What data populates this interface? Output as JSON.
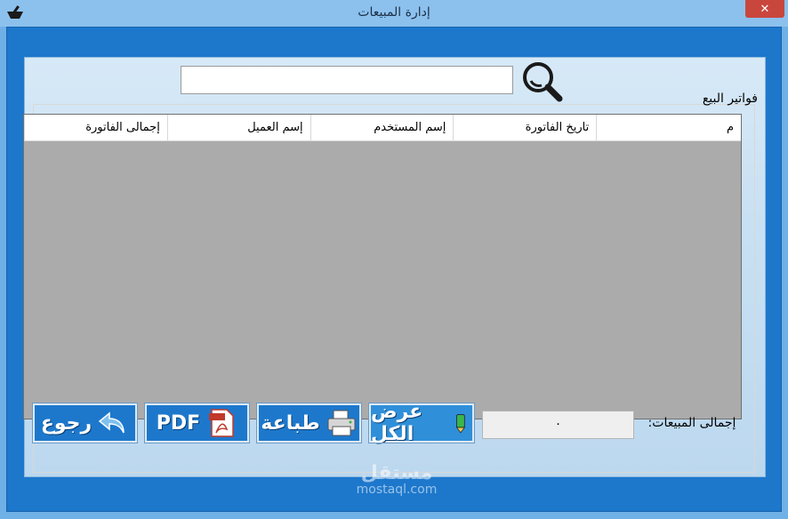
{
  "window": {
    "title": "إدارة المبيعات",
    "close_label": "✕"
  },
  "search": {
    "value": "",
    "placeholder": ""
  },
  "group": {
    "label": "فواتير البيع"
  },
  "table": {
    "columns": [
      "م",
      "تاريخ الفاتورة",
      "إسم المستخدم",
      "إسم العميل",
      "إجمالى الفاتورة"
    ],
    "rows": []
  },
  "totals": {
    "label": "إجمالى المبيعات:",
    "value": "٠"
  },
  "buttons": {
    "show_all": "عرض الكل",
    "print": "طباعة",
    "pdf": "PDF",
    "back": "رجوع"
  },
  "watermark": {
    "logo": "مستقل",
    "url": "mostaql.com"
  },
  "colors": {
    "accent": "#1d78cc",
    "title_bar": "#8cc1ee",
    "close": "#c9463d",
    "grid_bg": "#ababab"
  }
}
